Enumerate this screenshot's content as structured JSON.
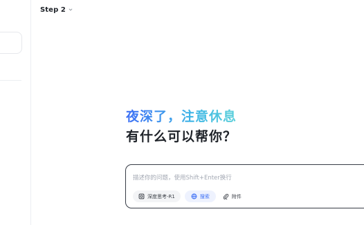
{
  "header": {
    "title": "Step 2",
    "dropdown_icon": "chevron-down-icon"
  },
  "greeting": {
    "line1": "夜深了，注意休息",
    "line2": "有什么可以帮你？"
  },
  "composer": {
    "placeholder": "描述你的问题，使用Shift+Enter换行",
    "deep_think": {
      "label": "深度思考-R1",
      "icon": "deep-think-icon"
    },
    "search": {
      "label": "搜索",
      "icon": "globe-icon"
    },
    "attach": {
      "label": "附件",
      "icon": "paperclip-icon"
    }
  },
  "colors": {
    "accent_blue": "#3b6ef5",
    "greeting_gradient_start": "#3d6ff5",
    "greeting_gradient_end": "#5cd0da",
    "text_dark": "#1f2329",
    "placeholder": "#a3a8b3"
  }
}
